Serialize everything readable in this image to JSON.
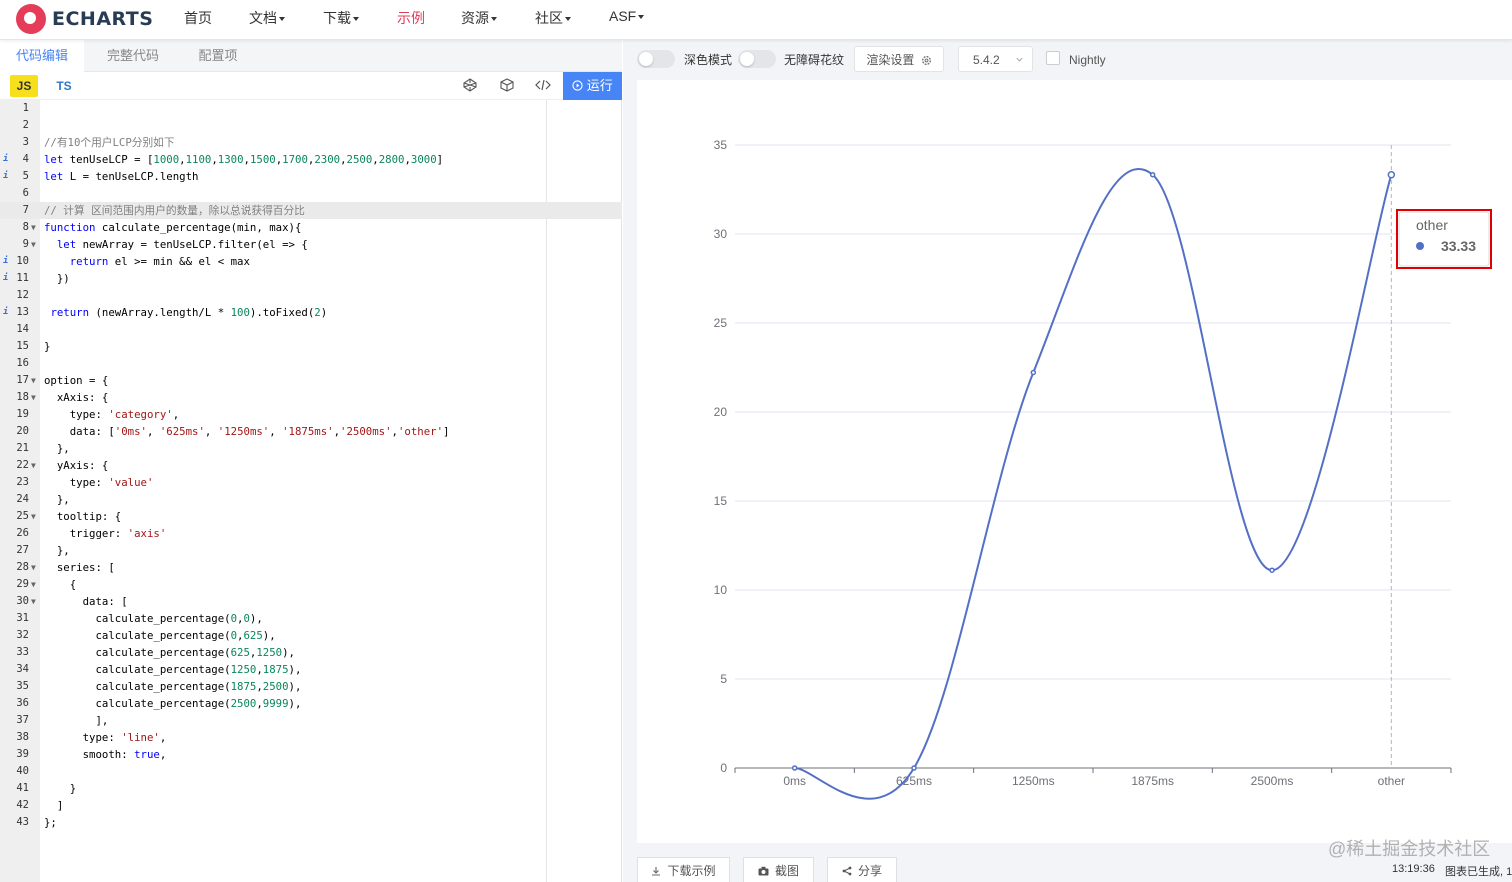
{
  "nav": {
    "logo_text": "ECHARTS",
    "items": [
      {
        "label": "首页",
        "dropdown": false
      },
      {
        "label": "文档",
        "dropdown": true
      },
      {
        "label": "下载",
        "dropdown": true
      },
      {
        "label": "示例",
        "dropdown": false,
        "active": true
      },
      {
        "label": "资源",
        "dropdown": true
      },
      {
        "label": "社区",
        "dropdown": true
      },
      {
        "label": "ASF",
        "dropdown": true
      }
    ]
  },
  "editor_tabs": [
    {
      "label": "代码编辑",
      "active": true
    },
    {
      "label": "完整代码",
      "active": false
    },
    {
      "label": "配置项",
      "active": false
    }
  ],
  "toolbar": {
    "js_label": "JS",
    "ts_label": "TS",
    "run_label": "运行",
    "icons": [
      "codepen-icon",
      "codesandbox-icon",
      "code-icon",
      "play-circle-icon"
    ]
  },
  "code": {
    "highlighted_line": 7,
    "lines": [
      {
        "n": 1,
        "text": ""
      },
      {
        "n": 2,
        "text": ""
      },
      {
        "n": 3,
        "text": "//有10个用户LCP分别如下"
      },
      {
        "n": 4,
        "text": "let tenUseLCP = [1000,1100,1300,1500,1700,2300,2500,2800,3000]",
        "info": true
      },
      {
        "n": 5,
        "text": "let L = tenUseLCP.length",
        "info": true
      },
      {
        "n": 6,
        "text": ""
      },
      {
        "n": 7,
        "text": "// 计算 区间范围内用户的数量，除以总说获得百分比"
      },
      {
        "n": 8,
        "text": "function calculate_percentage(min, max){",
        "fold": true
      },
      {
        "n": 9,
        "text": "  let newArray = tenUseLCP.filter(el => {",
        "fold": true
      },
      {
        "n": 10,
        "text": "    return el >= min && el < max",
        "info": true
      },
      {
        "n": 11,
        "text": "  })",
        "info": true
      },
      {
        "n": 12,
        "text": ""
      },
      {
        "n": 13,
        "text": " return (newArray.length/L * 100).toFixed(2)",
        "info": true
      },
      {
        "n": 14,
        "text": ""
      },
      {
        "n": 15,
        "text": "}"
      },
      {
        "n": 16,
        "text": ""
      },
      {
        "n": 17,
        "text": "option = {",
        "fold": true
      },
      {
        "n": 18,
        "text": "  xAxis: {",
        "fold": true
      },
      {
        "n": 19,
        "text": "    type: 'category',"
      },
      {
        "n": 20,
        "text": "    data: ['0ms', '625ms', '1250ms', '1875ms','2500ms','other']"
      },
      {
        "n": 21,
        "text": "  },"
      },
      {
        "n": 22,
        "text": "  yAxis: {",
        "fold": true
      },
      {
        "n": 23,
        "text": "    type: 'value'"
      },
      {
        "n": 24,
        "text": "  },"
      },
      {
        "n": 25,
        "text": "  tooltip: {",
        "fold": true
      },
      {
        "n": 26,
        "text": "    trigger: 'axis'"
      },
      {
        "n": 27,
        "text": "  },"
      },
      {
        "n": 28,
        "text": "  series: [",
        "fold": true
      },
      {
        "n": 29,
        "text": "    {",
        "fold": true
      },
      {
        "n": 30,
        "text": "      data: [",
        "fold": true
      },
      {
        "n": 31,
        "text": "        calculate_percentage(0,0),"
      },
      {
        "n": 32,
        "text": "        calculate_percentage(0,625),"
      },
      {
        "n": 33,
        "text": "        calculate_percentage(625,1250),"
      },
      {
        "n": 34,
        "text": "        calculate_percentage(1250,1875),"
      },
      {
        "n": 35,
        "text": "        calculate_percentage(1875,2500),"
      },
      {
        "n": 36,
        "text": "        calculate_percentage(2500,9999),"
      },
      {
        "n": 37,
        "text": "        ],"
      },
      {
        "n": 38,
        "text": "      type: 'line',"
      },
      {
        "n": 39,
        "text": "      smooth: true,"
      },
      {
        "n": 40,
        "text": ""
      },
      {
        "n": 41,
        "text": "    }"
      },
      {
        "n": 42,
        "text": "  ]"
      },
      {
        "n": 43,
        "text": "};"
      }
    ]
  },
  "preview_toolbar": {
    "dark_mode_label": "深色模式",
    "dark_mode_on": false,
    "no_pattern_label": "无障碍花纹",
    "no_pattern_on": false,
    "render_settings_label": "渲染设置",
    "version_label": "5.4.2",
    "nightly_label": "Nightly",
    "nightly_checked": false
  },
  "chart_data": {
    "type": "line",
    "smooth": true,
    "categories": [
      "0ms",
      "625ms",
      "1250ms",
      "1875ms",
      "2500ms",
      "other"
    ],
    "values": [
      0,
      0,
      22.22,
      33.33,
      11.11,
      33.33
    ],
    "y_ticks": [
      0,
      5,
      10,
      15,
      20,
      25,
      30,
      35
    ],
    "ylim": [
      0,
      35
    ],
    "color": "#5470c6",
    "tooltip": {
      "category": "other",
      "value": "33.33"
    },
    "highlight_color": "#e00000"
  },
  "bottom": {
    "download_label": "下载示例",
    "screenshot_label": "截图",
    "share_label": "分享",
    "time": "13:19:36",
    "status_text": "图表已生成, 1",
    "watermark": "@稀土掘金技术社区"
  }
}
